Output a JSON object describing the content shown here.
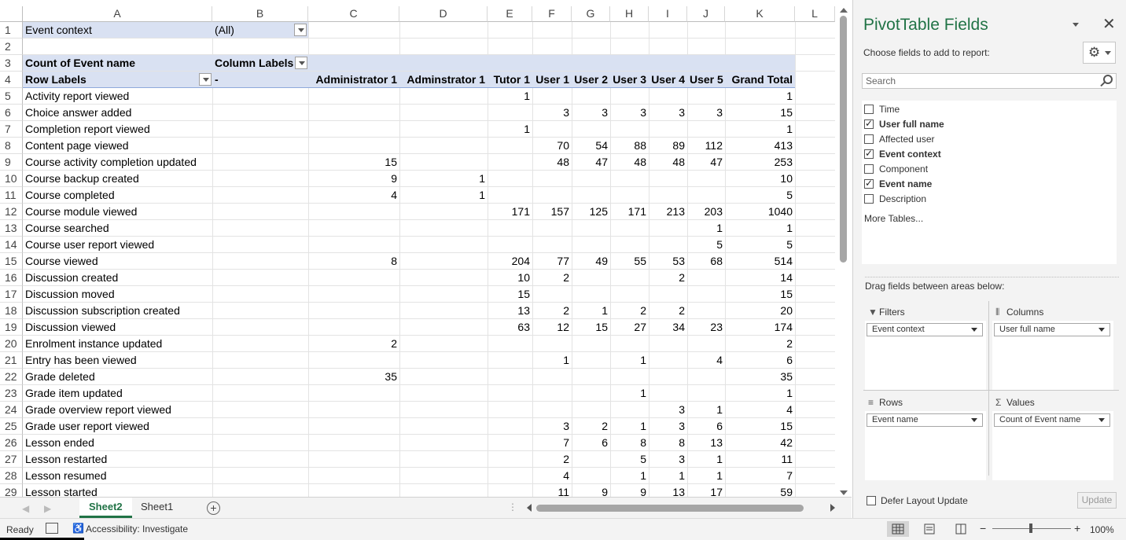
{
  "columns": [
    "A",
    "B",
    "C",
    "D",
    "E",
    "F",
    "G",
    "H",
    "I",
    "J",
    "K",
    "L"
  ],
  "filter": {
    "label": "Event context",
    "value": "(All)"
  },
  "pivot_header": {
    "count_label": "Count of Event name",
    "column_labels": "Column Labels",
    "row_labels": "Row Labels",
    "dash": "-",
    "col_names": [
      "Administrator 1",
      "Adminstrator 1",
      "Tutor 1",
      "User 1",
      "User 2",
      "User 3",
      "User 4",
      "User 5",
      "Grand Total"
    ]
  },
  "rows": [
    {
      "n": "5",
      "label": "Activity report viewed",
      "v": [
        "",
        "",
        "1",
        "",
        "",
        "",
        "",
        "",
        "1"
      ]
    },
    {
      "n": "6",
      "label": "Choice answer added",
      "v": [
        "",
        "",
        "",
        "3",
        "3",
        "3",
        "3",
        "3",
        "15"
      ]
    },
    {
      "n": "7",
      "label": "Completion report viewed",
      "v": [
        "",
        "",
        "1",
        "",
        "",
        "",
        "",
        "",
        "1"
      ]
    },
    {
      "n": "8",
      "label": "Content page viewed",
      "v": [
        "",
        "",
        "",
        "70",
        "54",
        "88",
        "89",
        "112",
        "413"
      ]
    },
    {
      "n": "9",
      "label": "Course activity completion updated",
      "v": [
        "15",
        "",
        "",
        "48",
        "47",
        "48",
        "48",
        "47",
        "253"
      ]
    },
    {
      "n": "10",
      "label": "Course backup created",
      "v": [
        "9",
        "1",
        "",
        "",
        "",
        "",
        "",
        "",
        "10"
      ]
    },
    {
      "n": "11",
      "label": "Course completed",
      "v": [
        "4",
        "1",
        "",
        "",
        "",
        "",
        "",
        "",
        "5"
      ]
    },
    {
      "n": "12",
      "label": "Course module viewed",
      "v": [
        "",
        "",
        "171",
        "157",
        "125",
        "171",
        "213",
        "203",
        "1040"
      ]
    },
    {
      "n": "13",
      "label": "Course searched",
      "v": [
        "",
        "",
        "",
        "",
        "",
        "",
        "",
        "1",
        "1"
      ]
    },
    {
      "n": "14",
      "label": "Course user report viewed",
      "v": [
        "",
        "",
        "",
        "",
        "",
        "",
        "",
        "5",
        "5"
      ]
    },
    {
      "n": "15",
      "label": "Course viewed",
      "v": [
        "8",
        "",
        "204",
        "77",
        "49",
        "55",
        "53",
        "68",
        "514"
      ]
    },
    {
      "n": "16",
      "label": "Discussion created",
      "v": [
        "",
        "",
        "10",
        "2",
        "",
        "",
        "2",
        "",
        "14"
      ]
    },
    {
      "n": "17",
      "label": "Discussion moved",
      "v": [
        "",
        "",
        "15",
        "",
        "",
        "",
        "",
        "",
        "15"
      ]
    },
    {
      "n": "18",
      "label": "Discussion subscription created",
      "v": [
        "",
        "",
        "13",
        "2",
        "1",
        "2",
        "2",
        "",
        "20"
      ]
    },
    {
      "n": "19",
      "label": "Discussion viewed",
      "v": [
        "",
        "",
        "63",
        "12",
        "15",
        "27",
        "34",
        "23",
        "174"
      ]
    },
    {
      "n": "20",
      "label": "Enrolment instance updated",
      "v": [
        "2",
        "",
        "",
        "",
        "",
        "",
        "",
        "",
        "2"
      ]
    },
    {
      "n": "21",
      "label": "Entry has been viewed",
      "v": [
        "",
        "",
        "",
        "1",
        "",
        "1",
        "",
        "4",
        "6"
      ]
    },
    {
      "n": "22",
      "label": "Grade deleted",
      "v": [
        "35",
        "",
        "",
        "",
        "",
        "",
        "",
        "",
        "35"
      ]
    },
    {
      "n": "23",
      "label": "Grade item updated",
      "v": [
        "",
        "",
        "",
        "",
        "",
        "1",
        "",
        "",
        "1"
      ]
    },
    {
      "n": "24",
      "label": "Grade overview report viewed",
      "v": [
        "",
        "",
        "",
        "",
        "",
        "",
        "3",
        "1",
        "4"
      ]
    },
    {
      "n": "25",
      "label": "Grade user report viewed",
      "v": [
        "",
        "",
        "",
        "3",
        "2",
        "1",
        "3",
        "6",
        "15"
      ]
    },
    {
      "n": "26",
      "label": "Lesson ended",
      "v": [
        "",
        "",
        "",
        "7",
        "6",
        "8",
        "8",
        "13",
        "42"
      ]
    },
    {
      "n": "27",
      "label": "Lesson restarted",
      "v": [
        "",
        "",
        "",
        "2",
        "",
        "5",
        "3",
        "1",
        "11"
      ]
    },
    {
      "n": "28",
      "label": "Lesson resumed",
      "v": [
        "",
        "",
        "",
        "4",
        "",
        "1",
        "1",
        "1",
        "7"
      ]
    },
    {
      "n": "29",
      "label": "Lesson started",
      "v": [
        "",
        "",
        "",
        "11",
        "9",
        "9",
        "13",
        "17",
        "59"
      ]
    }
  ],
  "sheets": [
    "Sheet2",
    "Sheet1"
  ],
  "status": {
    "ready": "Ready",
    "accessibility": "Accessibility: Investigate",
    "zoom": "100%"
  },
  "pane": {
    "title": "PivotTable Fields",
    "choose": "Choose fields to add to report:",
    "search_placeholder": "Search",
    "fields": [
      {
        "label": "Time",
        "checked": false
      },
      {
        "label": "User full name",
        "checked": true
      },
      {
        "label": "Affected user",
        "checked": false
      },
      {
        "label": "Event context",
        "checked": true
      },
      {
        "label": "Component",
        "checked": false
      },
      {
        "label": "Event name",
        "checked": true
      },
      {
        "label": "Description",
        "checked": false
      }
    ],
    "more_tables": "More Tables...",
    "drag_text": "Drag fields between areas below:",
    "areas": {
      "filters": {
        "title": "Filters",
        "item": "Event context"
      },
      "columns": {
        "title": "Columns",
        "item": "User full name"
      },
      "rows": {
        "title": "Rows",
        "item": "Event name"
      },
      "values": {
        "title": "Values",
        "item": "Count of Event name"
      }
    },
    "defer": "Defer Layout Update",
    "update": "Update"
  },
  "colors": {
    "accent": "#217346",
    "pivot_band": "#d9e1f2"
  }
}
